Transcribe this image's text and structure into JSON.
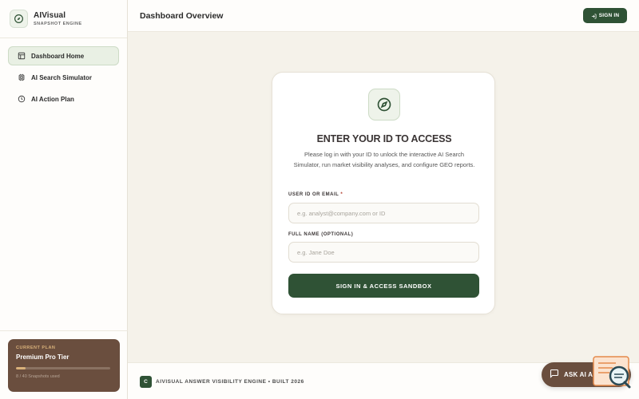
{
  "brand": {
    "name": "AIVisual",
    "subtitle": "SNAPSHOT ENGINE"
  },
  "sidebar": {
    "items": [
      {
        "label": "Dashboard Home",
        "icon": "layout-icon",
        "active": true
      },
      {
        "label": "AI Search Simulator",
        "icon": "cpu-icon",
        "active": false
      },
      {
        "label": "AI Action Plan",
        "icon": "clock-icon",
        "active": false
      }
    ],
    "plan": {
      "label": "CURRENT PLAN",
      "name": "Premium Pro Tier",
      "usage": "8 / 40 Snapshots used",
      "used_fraction": 0.1
    }
  },
  "header": {
    "title": "Dashboard Overview",
    "signin_label": "SIGN IN",
    "signin_icon": "login-icon"
  },
  "login": {
    "icon": "compass-icon",
    "title": "ENTER YOUR ID TO ACCESS",
    "description": "Please log in with your ID to unlock the interactive AI Search Simulator, run market visibility analyses, and configure GEO reports.",
    "user_label": "USER ID OR EMAIL",
    "user_required": "*",
    "user_placeholder": "e.g. analyst@company.com or ID",
    "user_value": "",
    "name_label": "FULL NAME (OPTIONAL)",
    "name_placeholder": "e.g. Jane Doe",
    "name_value": "",
    "submit_label": "SIGN IN & ACCESS SANDBOX"
  },
  "footer": {
    "logo": "C",
    "text": "AIVISUAL ANSWER VISIBILITY ENGINE • BUILT 2026"
  },
  "ask_ai": {
    "label": "ASK AI ADVISOR",
    "icon": "chat-icon"
  },
  "colors": {
    "accent": "#2f5235",
    "brown": "#6a4e3e",
    "gold": "#d9b17a",
    "background": "#f5f2ea"
  }
}
